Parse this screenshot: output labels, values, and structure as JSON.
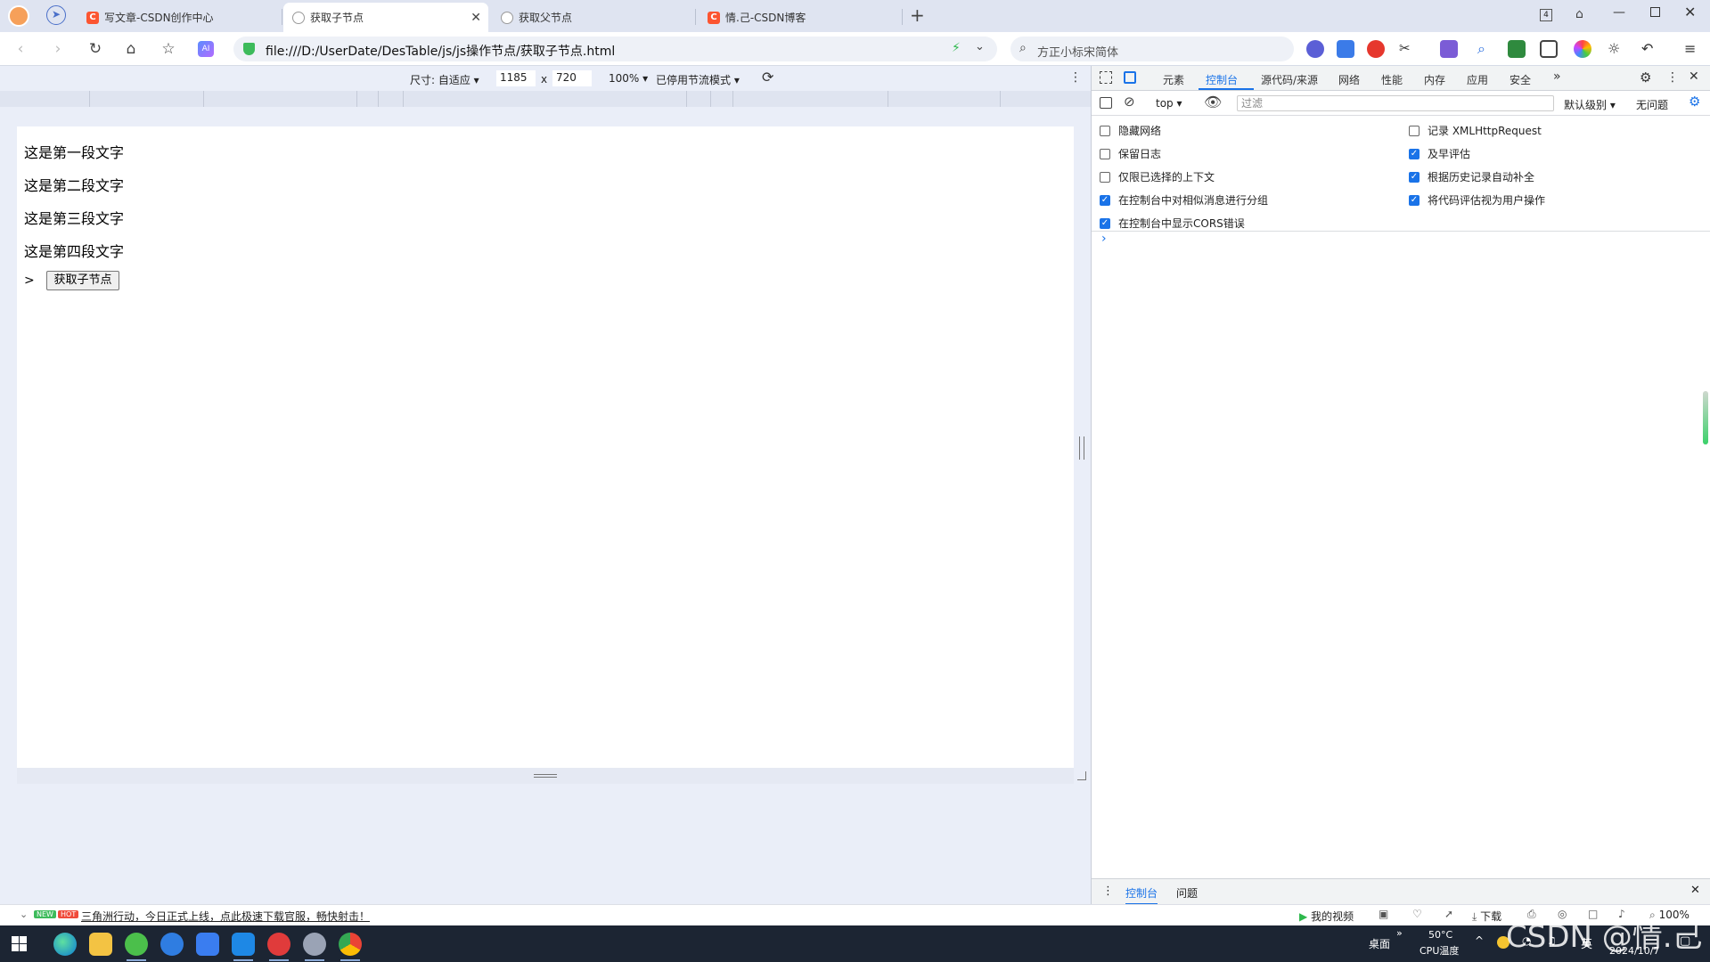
{
  "tabs": [
    {
      "label": "写文章-CSDN创作中心",
      "type": "csdn"
    },
    {
      "label": "获取子节点",
      "type": "globe",
      "active": true
    },
    {
      "label": "获取父节点",
      "type": "globe"
    },
    {
      "label": "情.己-CSDN博客",
      "type": "csdn"
    }
  ],
  "window": {
    "tab_count": "4"
  },
  "address": {
    "url": "file:///D:/UserDate/DesTable/js/js操作节点/获取子节点.html"
  },
  "search": {
    "placeholder": "方正小标宋简体"
  },
  "device_toolbar": {
    "size_label": "尺寸: 自适应",
    "width": "1185",
    "times": "x",
    "height": "720",
    "zoom": "100%",
    "throttle": "已停用节流模式"
  },
  "page": {
    "paragraphs": [
      "这是第一段文字",
      "这是第二段文字",
      "这是第三段文字",
      "这是第四段文字"
    ],
    "prompt": ">",
    "button_label": "获取子节点"
  },
  "devtools": {
    "tabs": [
      "元素",
      "控制台",
      "源代码/来源",
      "网络",
      "性能",
      "内存",
      "应用",
      "安全"
    ],
    "active_tab": "控制台",
    "context": "top",
    "filter_placeholder": "过滤",
    "level": "默认级别",
    "issues": "无问题",
    "options_left": [
      {
        "label": "隐藏网络",
        "checked": false
      },
      {
        "label": "保留日志",
        "checked": false
      },
      {
        "label": "仅限已选择的上下文",
        "checked": false
      },
      {
        "label": "在控制台中对相似消息进行分组",
        "checked": true
      },
      {
        "label": "在控制台中显示CORS错误",
        "checked": true
      }
    ],
    "options_right": [
      {
        "label": "记录 XMLHttpRequest",
        "checked": false
      },
      {
        "label": "及早评估",
        "checked": true
      },
      {
        "label": "根据历史记录自动补全",
        "checked": true
      },
      {
        "label": "将代码评估视为用户操作",
        "checked": true
      }
    ],
    "console_prompt": "›",
    "drawer_tabs": [
      "控制台",
      "问题"
    ]
  },
  "statusbar": {
    "badge_new": "NEW",
    "badge_hot": "HOT",
    "news": "三角洲行动，今日正式上线，点此极速下载官服，畅快射击！",
    "my_video": "我的视频",
    "download": "下载",
    "zoom": "100%"
  },
  "taskbar": {
    "desktop": "桌面",
    "temp": "50°C",
    "temp_label": "CPU温度",
    "ime": "英",
    "date": "2024/10/7",
    "watermark": "CSDN @情.己"
  }
}
